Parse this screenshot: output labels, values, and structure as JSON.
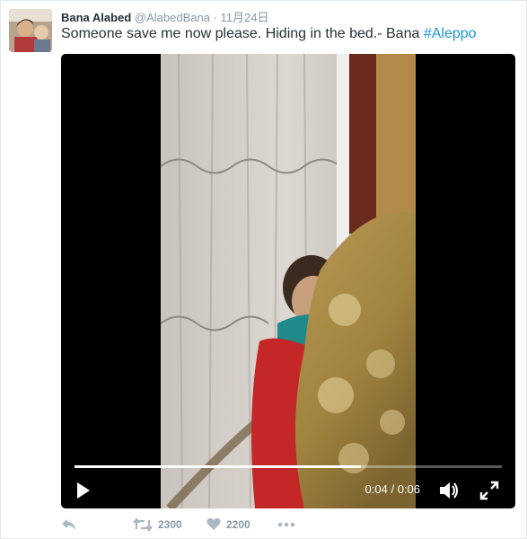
{
  "tweet": {
    "author": {
      "name": "Bana Alabed",
      "handle": "@AlabedBana",
      "time": "· 11月24日"
    },
    "text": "Someone save me now please. Hiding in the bed.- Bana ",
    "hashtag": "#Aleppo",
    "video": {
      "current_time": "0:04",
      "duration": "0:06",
      "progress": 0.67,
      "icons": {
        "play": "play-icon",
        "volume": "volume-icon",
        "fullscreen": "fullscreen-icon"
      }
    },
    "actions": {
      "reply": {
        "icon": "reply-icon"
      },
      "retweet": {
        "icon": "retweet-icon",
        "count": "2300"
      },
      "like": {
        "icon": "heart-icon",
        "count": "2200"
      },
      "more": {
        "icon": "more-icon"
      }
    }
  },
  "colors": {
    "link": "#1b95e0",
    "text": "#292f33",
    "muted": "#8899a6"
  }
}
